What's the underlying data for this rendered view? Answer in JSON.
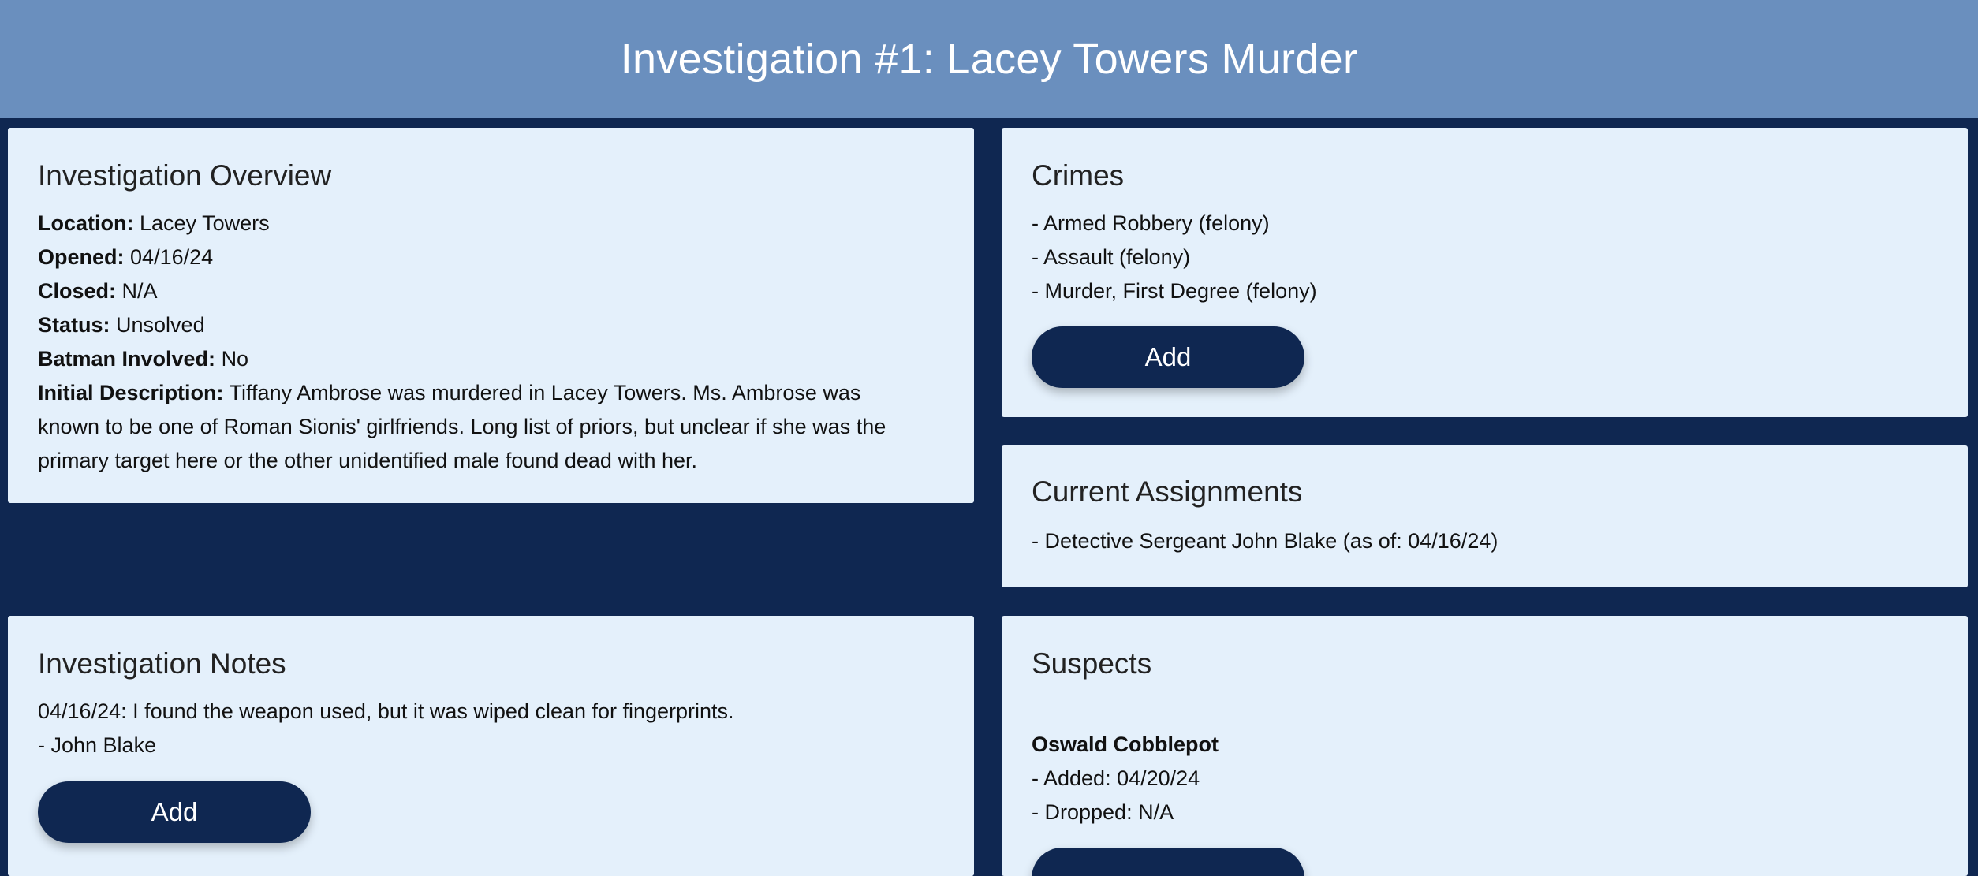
{
  "title": "Investigation #1: Lacey Towers Murder",
  "overview": {
    "heading": "Investigation Overview",
    "location_label": "Location:",
    "location": "Lacey Towers",
    "opened_label": "Opened:",
    "opened": "04/16/24",
    "closed_label": "Closed:",
    "closed": "N/A",
    "status_label": "Status:",
    "status": "Unsolved",
    "batman_label": "Batman Involved:",
    "batman": "No",
    "description_label": "Initial Description:",
    "description_lines": [
      "Tiffany Ambrose was murdered in Lacey Towers. Ms. Ambrose was",
      "known to be one of Roman Sionis' girlfriends. Long list of priors, but unclear if she was the",
      "primary target here or the other unidentified male found dead with her."
    ]
  },
  "crimes": {
    "heading": "Crimes",
    "items": [
      "- Armed Robbery (felony)",
      "- Assault (felony)",
      "- Murder, First Degree (felony)"
    ],
    "add_label": "Add"
  },
  "assignments": {
    "heading": "Current Assignments",
    "items": [
      "- Detective Sergeant John Blake (as of: 04/16/24)"
    ]
  },
  "notes": {
    "heading": "Investigation Notes",
    "text": "04/16/24: I found the weapon used, but it was wiped clean for fingerprints.",
    "author": "- John Blake",
    "add_label": "Add"
  },
  "suspects": {
    "heading": "Suspects",
    "name": "Oswald Cobblepot",
    "added": "- Added: 04/20/24",
    "dropped": "- Dropped: N/A"
  }
}
